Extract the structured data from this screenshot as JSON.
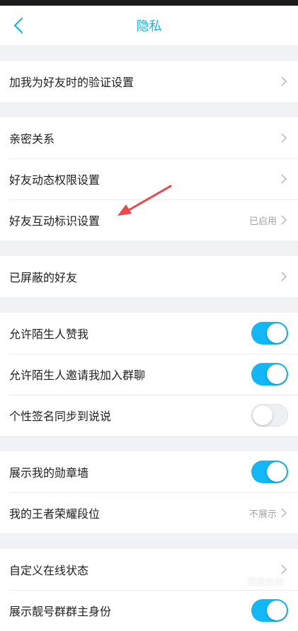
{
  "header": {
    "title": "隐私"
  },
  "groups": [
    {
      "rows": [
        {
          "label": "加我为好友时的验证设置"
        }
      ]
    },
    {
      "rows": [
        {
          "label": "亲密关系"
        },
        {
          "label": "好友动态权限设置"
        },
        {
          "label": "好友互动标识设置",
          "value": "已启用"
        }
      ]
    },
    {
      "rows": [
        {
          "label": "已屏蔽的好友"
        }
      ]
    },
    {
      "rows": [
        {
          "label": "允许陌生人赞我",
          "toggle": "on"
        },
        {
          "label": "允许陌生人邀请我加入群聊",
          "toggle": "on"
        },
        {
          "label": "个性签名同步到说说",
          "toggle": "off"
        }
      ]
    },
    {
      "rows": [
        {
          "label": "展示我的勋章墙",
          "toggle": "on"
        },
        {
          "label": "我的王者荣耀段位",
          "value": "不展示"
        }
      ]
    },
    {
      "rows": [
        {
          "label": "自定义在线状态"
        },
        {
          "label": "展示靓号群群主身份",
          "toggle": "on"
        }
      ]
    }
  ],
  "colors": {
    "accent": "#12b7f5",
    "arrow": "#f0454a"
  },
  "watermark": "百度经验"
}
